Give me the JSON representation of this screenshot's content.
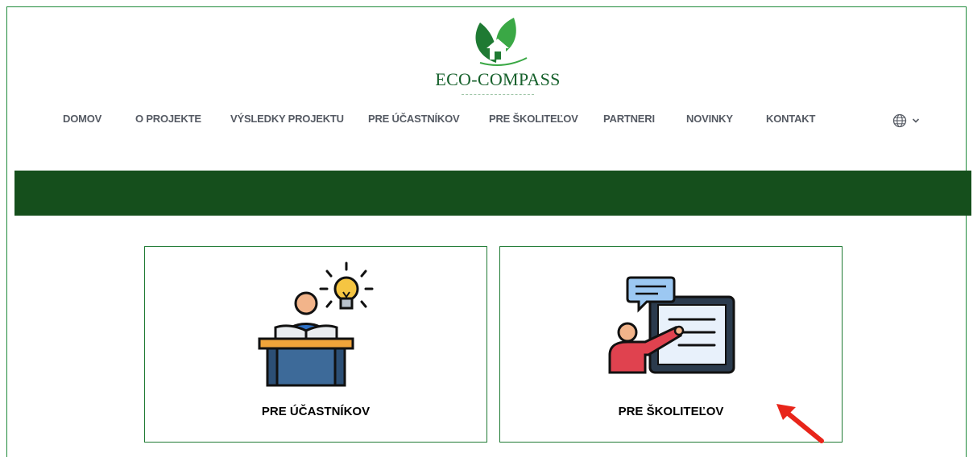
{
  "brand": {
    "name": "ECO-COMPASS",
    "colors": {
      "primary": "#17612c",
      "banner": "#154f1c",
      "nav_text": "#555a63",
      "annotation": "#e8251a"
    }
  },
  "nav": {
    "items": [
      "DOMOV",
      "O PROJEKTE",
      "VÝSLEDKY PROJEKTU",
      "PRE ÚČASTNÍKOV",
      "PRE ŠKOLITEĽOV",
      "PARTNERI",
      "NOVINKY",
      "KONTAKT"
    ],
    "language_icon": "globe-icon",
    "language_chevron": "chevron-down-icon"
  },
  "cards": [
    {
      "label": "PRE ÚČASTNÍKOV",
      "icon": "student-idea-icon"
    },
    {
      "label": "PRE ŠKOLITEĽOV",
      "icon": "trainer-presentation-icon"
    }
  ],
  "annotation": {
    "icon": "red-arrow-pointer",
    "color": "#e8251a"
  }
}
